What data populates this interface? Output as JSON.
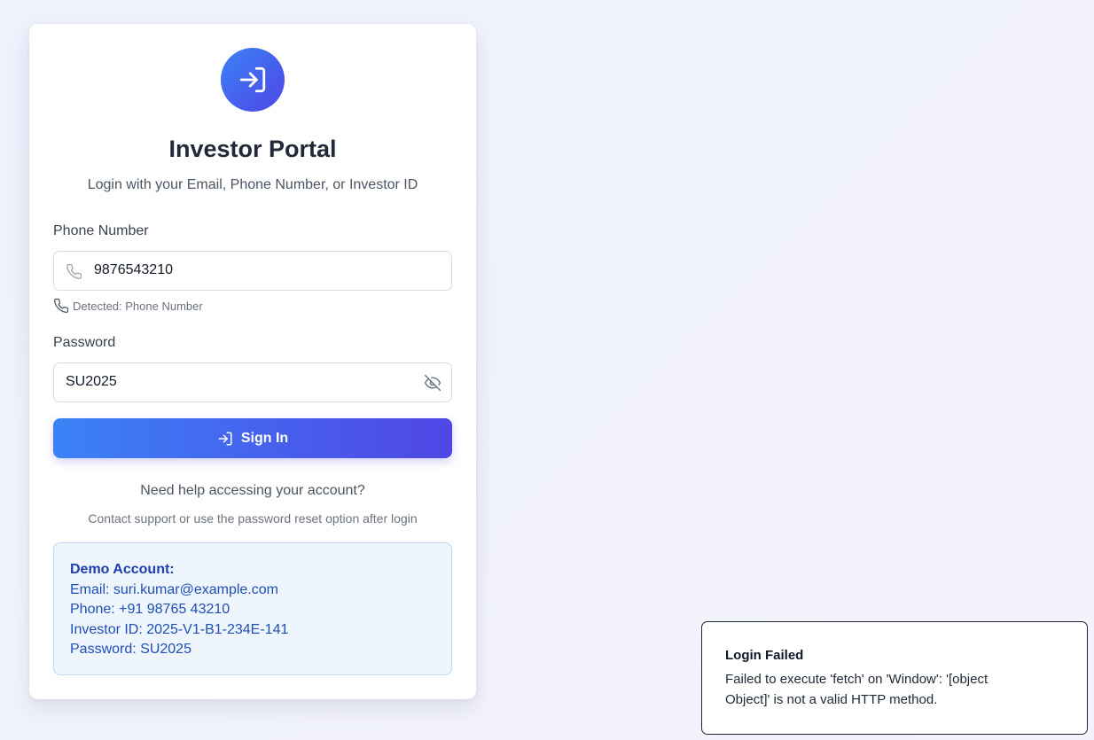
{
  "header": {
    "title": "Investor Portal",
    "subtitle": "Login with your Email, Phone Number, or Investor ID"
  },
  "form": {
    "identifier_label": "Phone Number",
    "identifier_value": "9876543210",
    "detected_text": "Detected: Phone Number",
    "password_label": "Password",
    "password_value": "SU2025",
    "submit_label": "Sign In"
  },
  "help": {
    "title": "Need help accessing your account?",
    "subtitle": "Contact support or use the password reset option after login"
  },
  "demo": {
    "heading": "Demo Account:",
    "email": "Email: suri.kumar@example.com",
    "phone": "Phone: +91 98765 43210",
    "investor_id": "Investor ID: 2025-V1-B1-234E-141",
    "password": "Password: SU2025"
  },
  "toast": {
    "title": "Login Failed",
    "message": "Failed to execute 'fetch' on 'Window': '[object Object]' is not a valid HTTP method."
  },
  "icons": {
    "logo": "login-icon",
    "phone": "phone-icon",
    "eye": "eye-off-icon",
    "button": "login-icon"
  },
  "colors": {
    "accent_start": "#3b82f6",
    "accent_end": "#4f46e5",
    "demo_bg": "#eff5fd",
    "demo_text": "#1e4fb5"
  }
}
